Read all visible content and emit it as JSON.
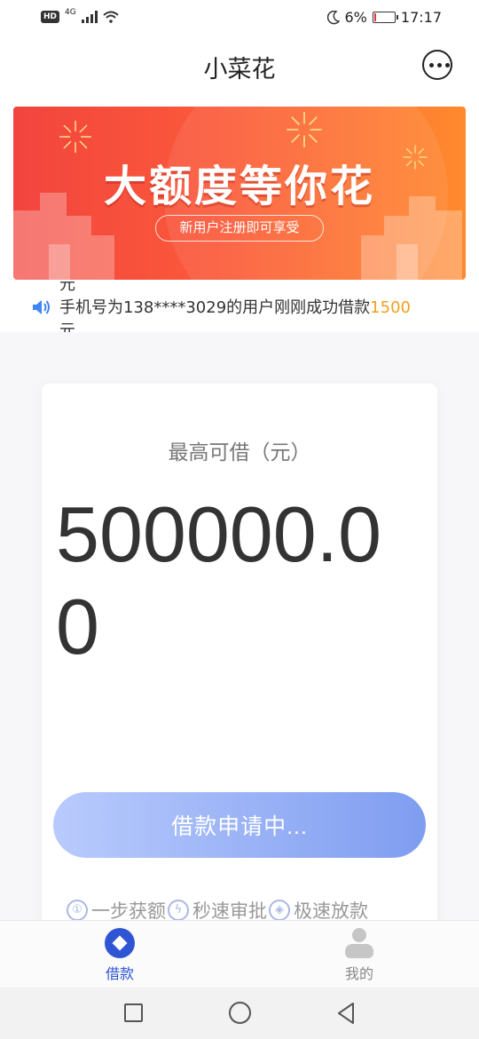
{
  "status_bar": {
    "hd": "HD",
    "network": "4G",
    "battery_percent": "6%",
    "battery_level": 0.06,
    "time": "17:17"
  },
  "header": {
    "title": "小菜花"
  },
  "banner": {
    "headline": "大额度等你花",
    "subtitle": "新用户注册即可享受"
  },
  "notice": {
    "prev_tail": "元",
    "text": "手机号为138****3029的用户刚刚成功借款",
    "amount": "1500",
    "unit": "元"
  },
  "loan_card": {
    "limit_label": "最高可借（元）",
    "limit_amount": "500000.00",
    "apply_label": "借款申请中...",
    "features": [
      {
        "icon": "①",
        "label": "一步获额"
      },
      {
        "icon": "ϟ",
        "label": "秒速审批"
      },
      {
        "icon": "◈",
        "label": "极速放款"
      }
    ]
  },
  "tab_bar": {
    "tabs": [
      {
        "label": "借款",
        "active": true
      },
      {
        "label": "我的",
        "active": false
      }
    ]
  },
  "colors": {
    "accent": "#2f55d4",
    "banner_start": "#f2443e",
    "banner_end": "#ff8a2e",
    "button_start": "#b9cbfd",
    "button_end": "#7f9df0",
    "highlight": "#f0a020"
  }
}
